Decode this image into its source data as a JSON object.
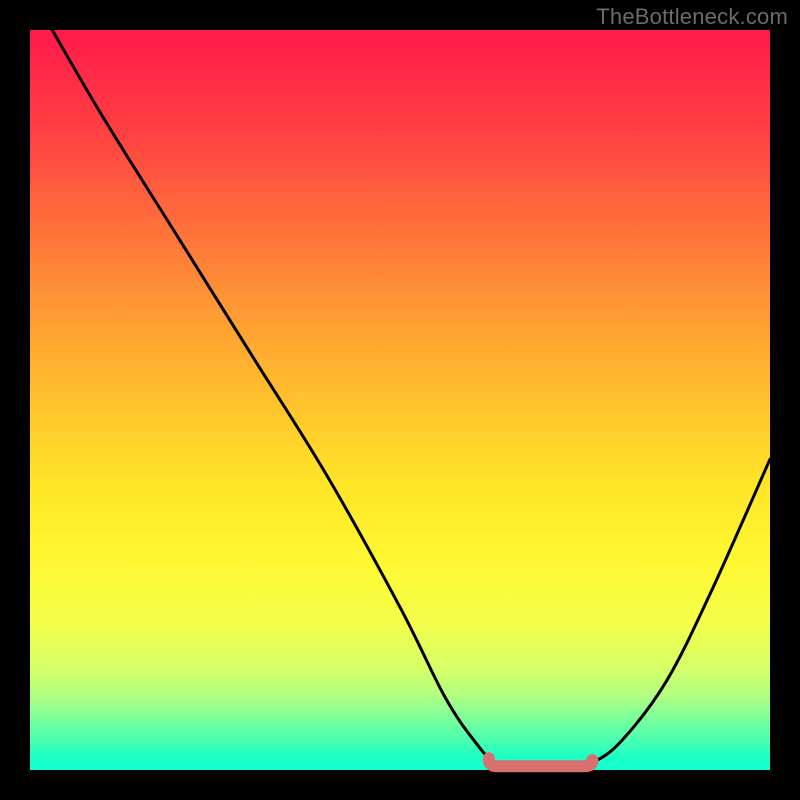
{
  "watermark": "TheBottleneck.com",
  "chart_data": {
    "type": "line",
    "title": "",
    "xlabel": "",
    "ylabel": "",
    "xlim": [
      0,
      100
    ],
    "ylim": [
      0,
      100
    ],
    "series": [
      {
        "name": "bottleneck-curve",
        "x": [
          3,
          10,
          20,
          30,
          40,
          50,
          56,
          60,
          63,
          68,
          72,
          76,
          80,
          86,
          92,
          100
        ],
        "y": [
          100,
          88,
          72,
          56,
          40,
          22,
          10,
          4,
          1,
          0,
          0,
          1,
          4,
          12,
          24,
          42
        ]
      }
    ],
    "flat_region": {
      "x_start": 62,
      "x_end": 76,
      "y": 0.5
    },
    "colors": {
      "curve": "#000000",
      "flat_marker": "#d9706f",
      "gradient_top": "#ff1a4b",
      "gradient_bottom": "#10ffd0",
      "frame": "#000000"
    }
  }
}
